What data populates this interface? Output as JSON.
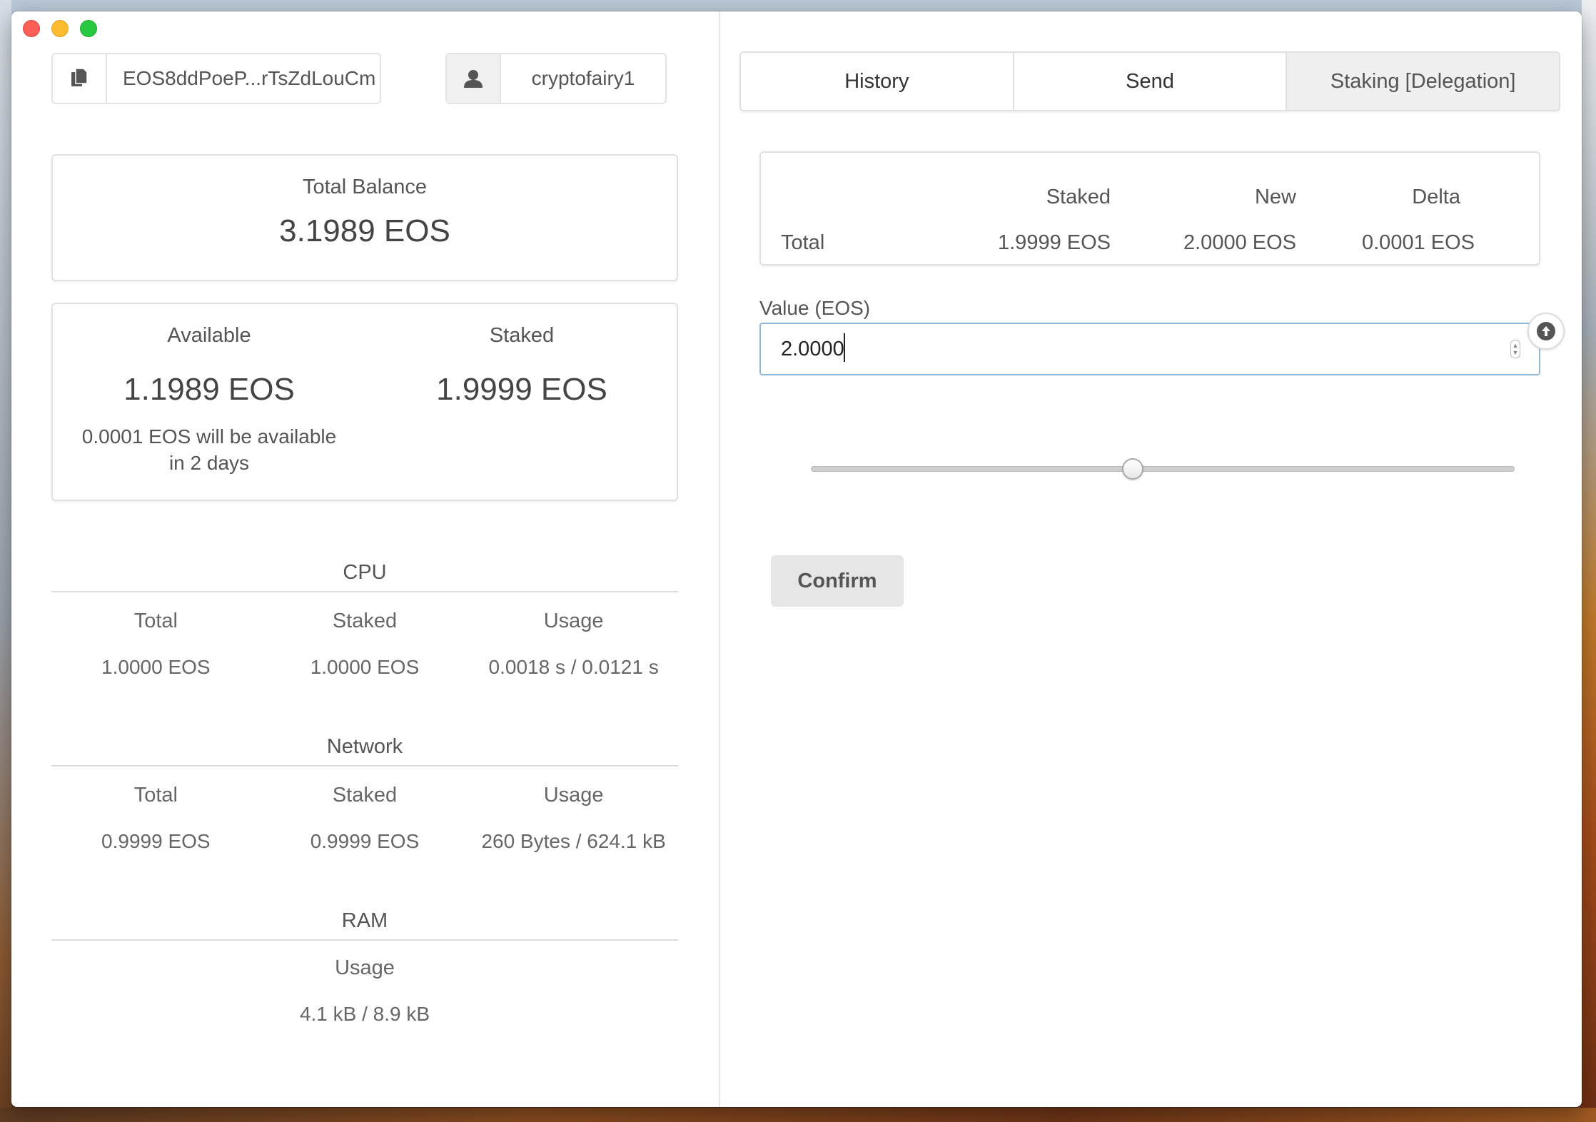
{
  "account": {
    "key_short": "EOS8ddPoeP...rTsZdLouCm",
    "username": "cryptofairy1"
  },
  "balance": {
    "label": "Total Balance",
    "value": "3.1989 EOS"
  },
  "available": {
    "label": "Available",
    "value": "1.1989 EOS",
    "note": "0.0001 EOS will be available in 2 days"
  },
  "staked": {
    "label": "Staked",
    "value": "1.9999 EOS"
  },
  "cpu": {
    "title": "CPU",
    "headers": [
      "Total",
      "Staked",
      "Usage"
    ],
    "values": [
      "1.0000 EOS",
      "1.0000 EOS",
      "0.0018 s / 0.0121 s"
    ]
  },
  "network": {
    "title": "Network",
    "headers": [
      "Total",
      "Staked",
      "Usage"
    ],
    "values": [
      "0.9999 EOS",
      "0.9999 EOS",
      "260 Bytes / 624.1 kB"
    ]
  },
  "ram": {
    "title": "RAM",
    "header": "Usage",
    "value": "4.1 kB / 8.9 kB"
  },
  "tabs": [
    "History",
    "Send",
    "Staking [Delegation]"
  ],
  "delta": {
    "headers": [
      "Staked",
      "New",
      "Delta"
    ],
    "row_label": "Total",
    "values": [
      "1.9999 EOS",
      "2.0000 EOS",
      "0.0001 EOS"
    ]
  },
  "value_field": {
    "label": "Value (EOS)",
    "value": "2.0000"
  },
  "slider": {
    "level": 0.457
  },
  "confirm_label": "Confirm",
  "icons": {
    "key": "copy-icon",
    "user": "user-icon",
    "upload": "arrow-up-circle-icon"
  }
}
